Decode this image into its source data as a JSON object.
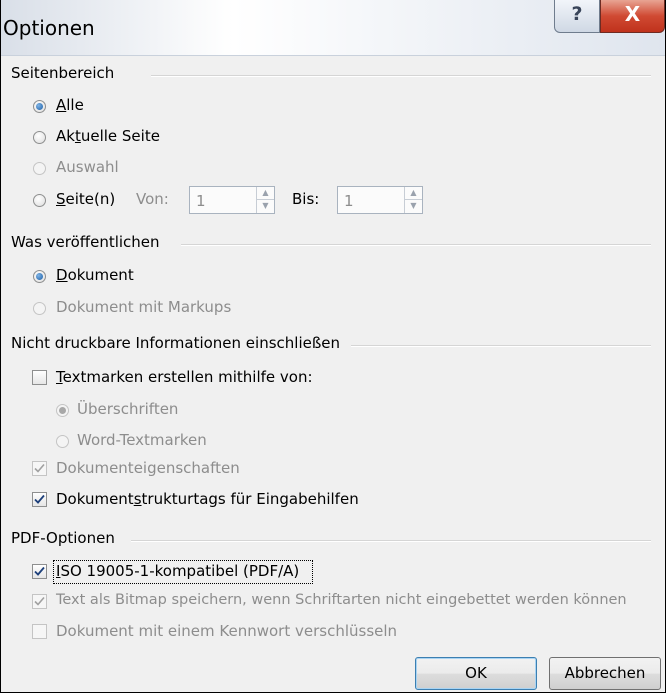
{
  "window": {
    "title": "Optionen",
    "help_glyph": "?",
    "close_glyph": "X"
  },
  "seitenbereich": {
    "label": "Seitenbereich",
    "alle": {
      "pre": "",
      "key": "A",
      "post": "lle",
      "selected": true
    },
    "aktuelle": {
      "pre": "Ak",
      "key": "t",
      "post": "uelle Seite"
    },
    "auswahl": {
      "label": "Auswahl"
    },
    "seiten": {
      "pre": "",
      "key": "S",
      "post": "eite(n)"
    },
    "von_label": "Von:",
    "von_value": "1",
    "bis_label": "Bis:",
    "bis_value": "1"
  },
  "was": {
    "label": "Was veröffentlichen",
    "dokument": {
      "pre": "",
      "key": "D",
      "post": "okument",
      "selected": true
    },
    "markups": {
      "label": "Dokument mit Markups"
    }
  },
  "nicht": {
    "label": "Nicht druckbare Informationen einschließen",
    "textmarken": {
      "pre": "",
      "key": "T",
      "post": "extmarken erstellen mithilfe von:",
      "checked": false
    },
    "ueberschriften": {
      "label": "Überschriften",
      "selected": true
    },
    "wordtextmarken": {
      "label": "Word-Textmarken"
    },
    "eigenschaften": {
      "label": "Dokumenteigenschaften",
      "checked": true
    },
    "strukturtags": {
      "pre": "Dokument",
      "key": "s",
      "post": "trukturtags für Eingabehilfen",
      "checked": true
    }
  },
  "pdf": {
    "label": "PDF-Optionen",
    "iso": {
      "pre": "",
      "key": "I",
      "post": "SO 19005-1-kompatibel (PDF/A)",
      "checked": true
    },
    "bitmap": {
      "label": "Text als Bitmap speichern, wenn Schriftarten nicht eingebettet werden können",
      "checked": true
    },
    "kennwort": {
      "label": "Dokument mit einem Kennwort verschlüsseln",
      "checked": false
    }
  },
  "buttons": {
    "ok": "OK",
    "cancel": "Abbrechen"
  }
}
